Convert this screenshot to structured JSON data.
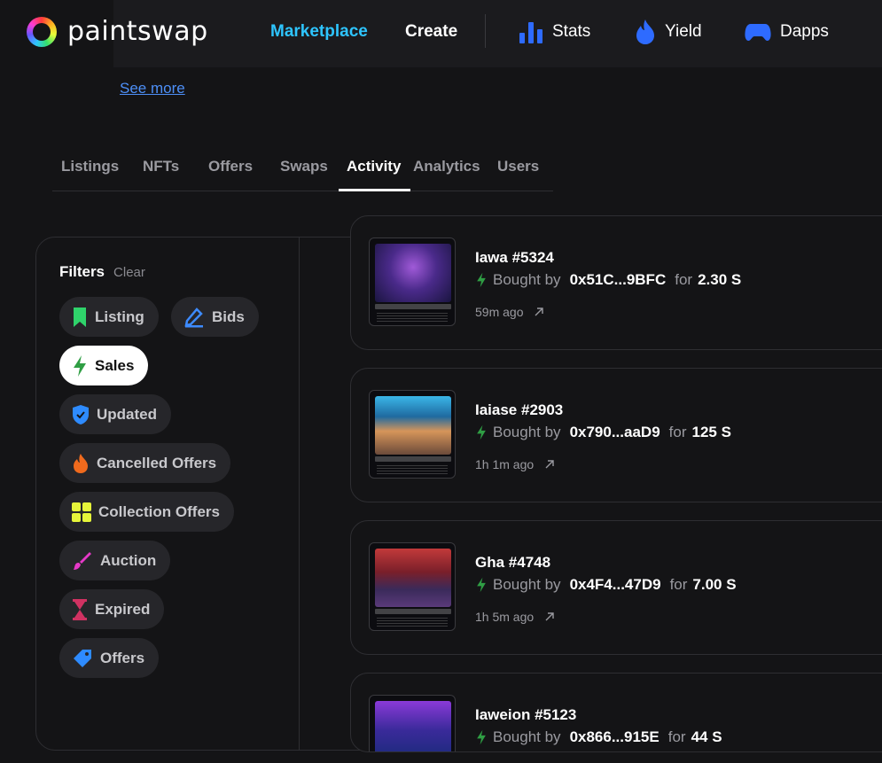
{
  "header": {
    "brand": "paintswap",
    "nav": {
      "marketplace": "Marketplace",
      "create": "Create",
      "stats": "Stats",
      "yield": "Yield",
      "dapps": "Dapps"
    },
    "accent_color": "#2ec5ff"
  },
  "description": {
    "see_more": "See more"
  },
  "tabs": [
    {
      "label": "Listings"
    },
    {
      "label": "NFTs"
    },
    {
      "label": "Offers"
    },
    {
      "label": "Swaps"
    },
    {
      "label": "Activity",
      "active": true
    },
    {
      "label": "Analytics"
    },
    {
      "label": "Users"
    }
  ],
  "filters": {
    "title": "Filters",
    "clear": "Clear",
    "chips": [
      {
        "label": "Listing",
        "icon": "bookmark-icon",
        "color": "#2fd36b"
      },
      {
        "label": "Bids",
        "icon": "pencil-icon",
        "color": "#3d8bff"
      },
      {
        "label": "Sales",
        "icon": "bolt-icon",
        "color": "#2f9e44",
        "active": true
      },
      {
        "label": "Updated",
        "icon": "shield-check-icon",
        "color": "#2e8bff"
      },
      {
        "label": "Cancelled Offers",
        "icon": "flame-icon",
        "color": "#f06a1d"
      },
      {
        "label": "Collection Offers",
        "icon": "grid-icon",
        "color": "#e6f53a"
      },
      {
        "label": "Auction",
        "icon": "brush-icon",
        "color": "#e639c8"
      },
      {
        "label": "Expired",
        "icon": "hourglass-icon",
        "color": "#d03262"
      },
      {
        "label": "Offers",
        "icon": "tag-icon",
        "color": "#2e8bff"
      }
    ]
  },
  "activity": [
    {
      "name": "Iawa #5324",
      "action": "Bought by",
      "buyer": "0x51C...9BFC",
      "for": "for",
      "price": "2.30 S",
      "time": "59m ago"
    },
    {
      "name": "Iaiase #2903",
      "action": "Bought by",
      "buyer": "0x790...aaD9",
      "for": "for",
      "price": "125 S",
      "time": "1h 1m ago"
    },
    {
      "name": "Gha #4748",
      "action": "Bought by",
      "buyer": "0x4F4...47D9",
      "for": "for",
      "price": "7.00 S",
      "time": "1h 5m ago"
    },
    {
      "name": "Iaweion #5123",
      "action": "Bought by",
      "buyer": "0x866...915E",
      "for": "for",
      "price": "44 S",
      "time": ""
    }
  ]
}
